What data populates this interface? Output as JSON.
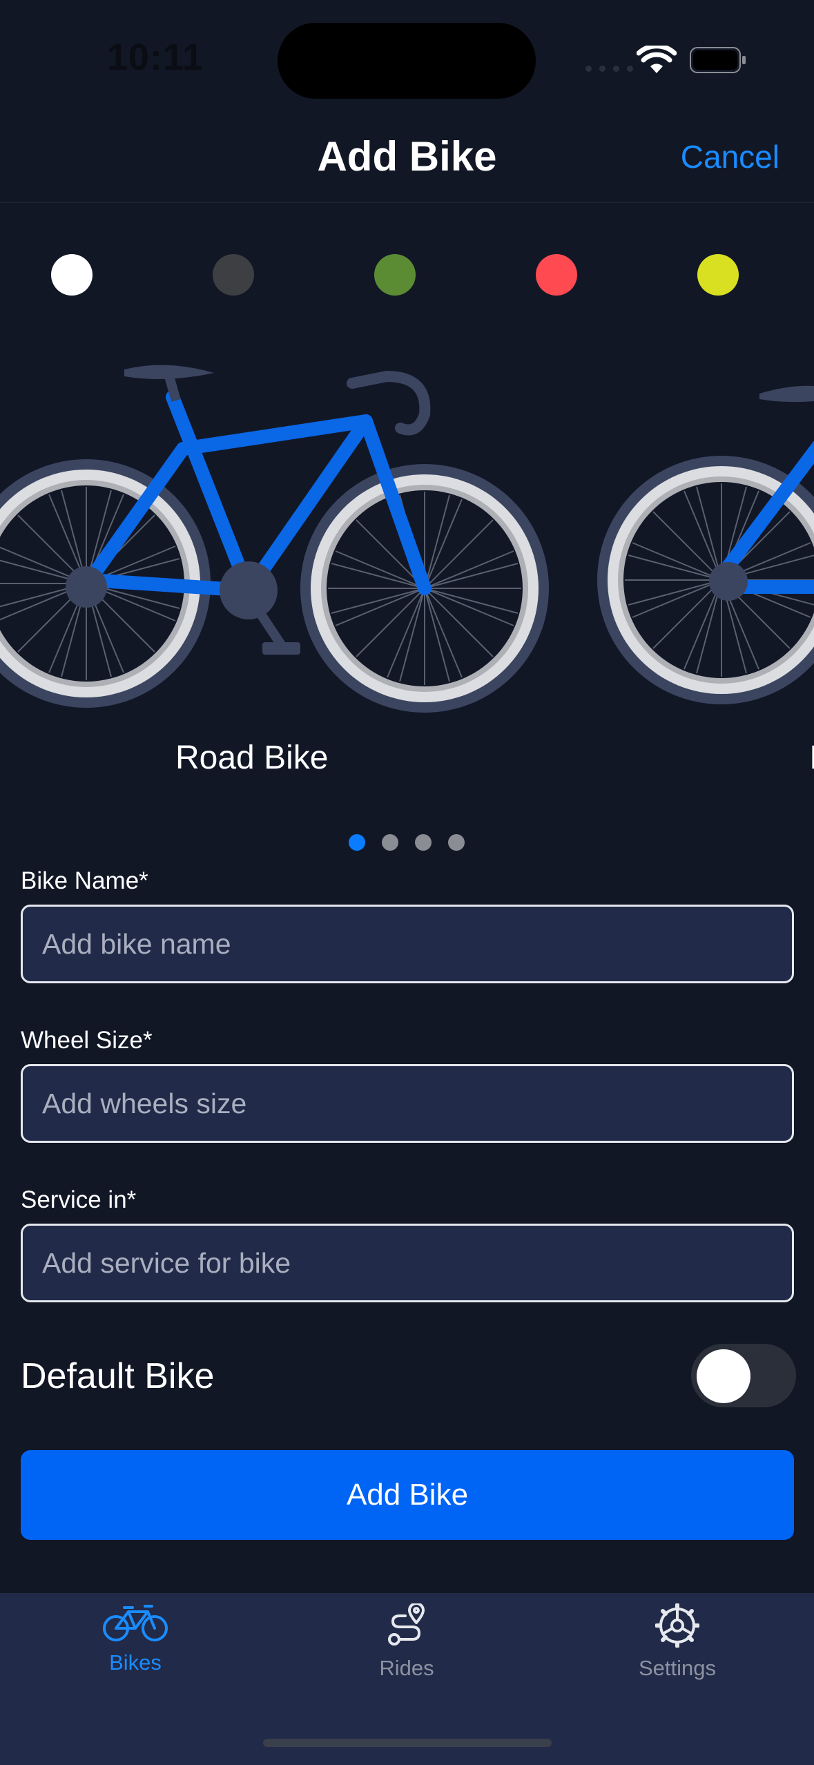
{
  "status_bar": {
    "time": "10:11"
  },
  "nav": {
    "title": "Add Bike",
    "cancel_label": "Cancel"
  },
  "colors": {
    "accent": "#0A7CFF",
    "background": "#121726",
    "swatches": [
      "#FFFFFF",
      "#3E3F43",
      "#5B8C34",
      "#FF4A52",
      "#D9E021"
    ],
    "frame": "#0A67E6"
  },
  "carousel": {
    "items": [
      "Road Bike"
    ],
    "page_count": 4,
    "current_page": 1
  },
  "form": {
    "bike_name": {
      "label": "Bike Name*",
      "placeholder": "Add bike name"
    },
    "wheel_size": {
      "label": "Wheel Size*",
      "placeholder": "Add wheels size"
    },
    "service": {
      "label": "Service in*",
      "placeholder": "Add service for bike"
    },
    "default_bike": {
      "label": "Default Bike",
      "on": false
    },
    "submit_label": "Add Bike"
  },
  "tab_bar": {
    "tabs": [
      {
        "label": "Bikes",
        "icon": "bicycle-icon",
        "active": true
      },
      {
        "label": "Rides",
        "icon": "route-icon",
        "active": false
      },
      {
        "label": "Settings",
        "icon": "gear-icon",
        "active": false
      }
    ]
  }
}
